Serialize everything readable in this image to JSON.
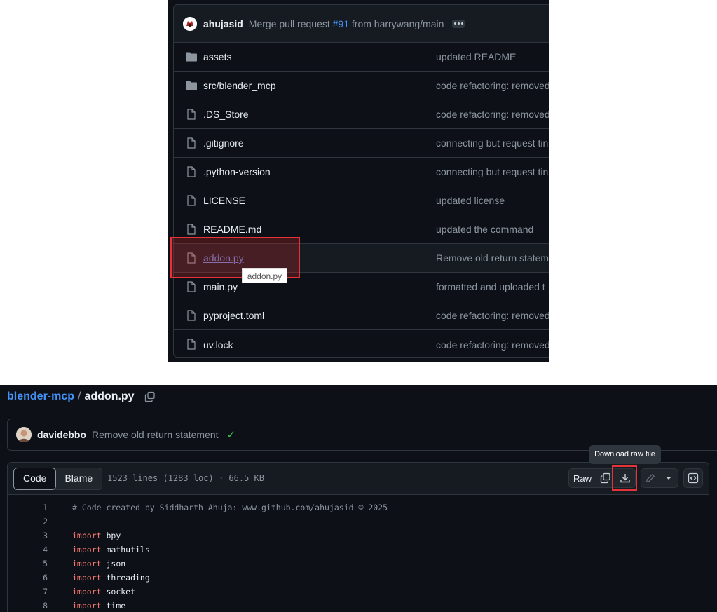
{
  "file_list": {
    "commit": {
      "user": "ahujasid",
      "message_prefix": "Merge pull request ",
      "pr_link": "#91",
      "message_suffix": " from harrywang/main"
    },
    "rows": [
      {
        "name": "assets",
        "type": "folder",
        "message": "updated README"
      },
      {
        "name": "src/blender_mcp",
        "type": "folder",
        "message": "code refactoring: removed"
      },
      {
        "name": ".DS_Store",
        "type": "file",
        "message": "code refactoring: removed"
      },
      {
        "name": ".gitignore",
        "type": "file",
        "message": "connecting but request tin"
      },
      {
        "name": ".python-version",
        "type": "file",
        "message": "connecting but request tin"
      },
      {
        "name": "LICENSE",
        "type": "file",
        "message": "updated license"
      },
      {
        "name": "README.md",
        "type": "file",
        "message": "updated the command"
      },
      {
        "name": "addon.py",
        "type": "file",
        "message": "Remove old return statem",
        "hovered": true
      },
      {
        "name": "main.py",
        "type": "file",
        "message": "formatted and uploaded t"
      },
      {
        "name": "pyproject.toml",
        "type": "file",
        "message": "code refactoring: removed"
      },
      {
        "name": "uv.lock",
        "type": "file",
        "message": "code refactoring: removed"
      }
    ],
    "hover_tooltip": "addon.py"
  },
  "file_view": {
    "breadcrumb": {
      "repo": "blender-mcp",
      "separator": "/",
      "file": "addon.py"
    },
    "commit": {
      "user": "davidebbo",
      "message": "Remove old return statement",
      "status": "✓"
    },
    "tabs": {
      "code": "Code",
      "blame": "Blame"
    },
    "meta": "1523 lines (1283 loc) · 66.5 KB",
    "toolbar": {
      "raw": "Raw",
      "download_tooltip": "Download raw file"
    },
    "code_lines": [
      {
        "num": "1",
        "kw": "",
        "text": "# Code created by Siddharth Ahuja: www.github.com/ahujasid © 2025",
        "comment": true
      },
      {
        "num": "2",
        "kw": "",
        "text": ""
      },
      {
        "num": "3",
        "kw": "import",
        "text": " bpy"
      },
      {
        "num": "4",
        "kw": "import",
        "text": " mathutils"
      },
      {
        "num": "5",
        "kw": "import",
        "text": " json"
      },
      {
        "num": "6",
        "kw": "import",
        "text": " threading"
      },
      {
        "num": "7",
        "kw": "import",
        "text": " socket"
      },
      {
        "num": "8",
        "kw": "import",
        "text": " time"
      }
    ]
  }
}
